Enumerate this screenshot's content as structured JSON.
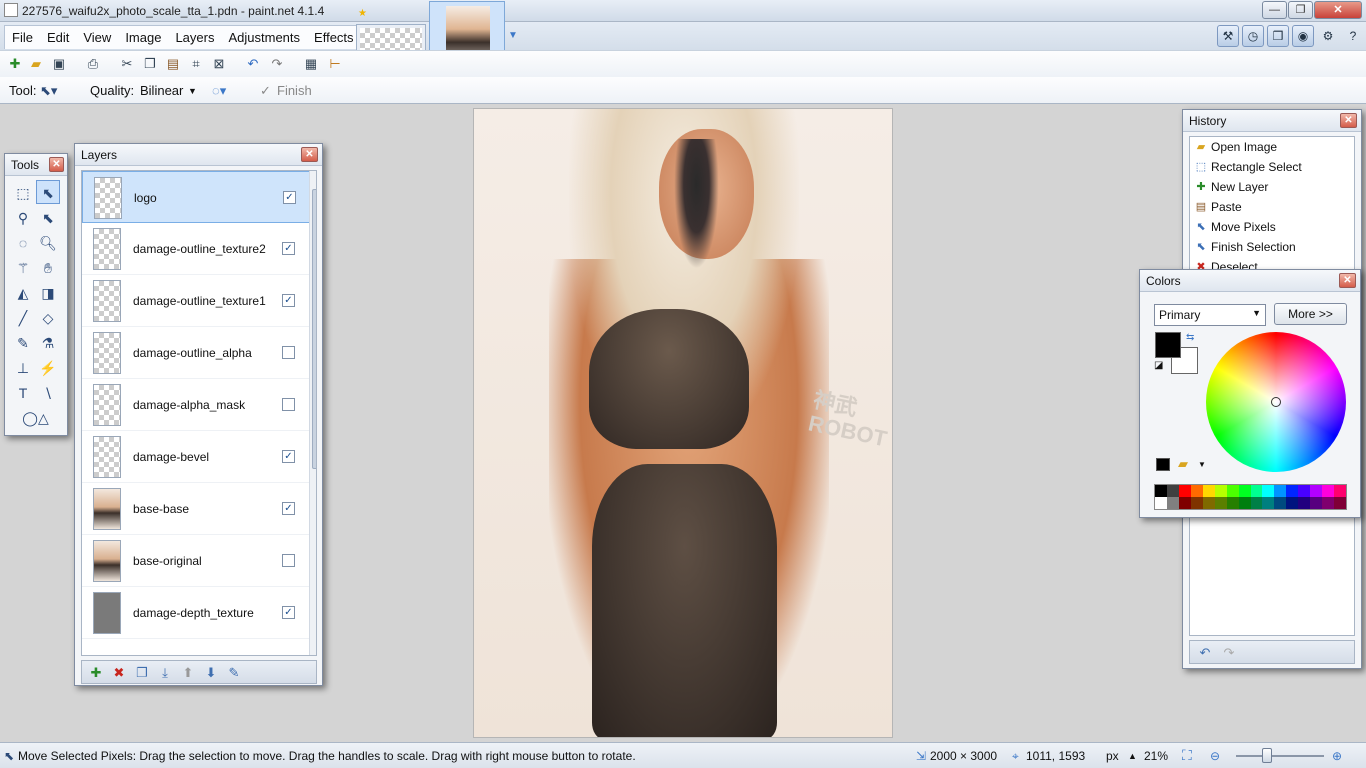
{
  "window": {
    "title": "227576_waifu2x_photo_scale_tta_1.pdn - paint.net 4.1.4",
    "min": "—",
    "max": "❐",
    "close": "✕"
  },
  "menu": [
    "File",
    "Edit",
    "View",
    "Image",
    "Layers",
    "Adjustments",
    "Effects"
  ],
  "tabs": {
    "thumb1_name": "logo document",
    "thumb2_name": "photo document",
    "active": 2
  },
  "toolbar": {
    "tool_label": "Tool:",
    "quality_label": "Quality:",
    "quality_value": "Bilinear",
    "finish_label": "Finish"
  },
  "tools_panel": {
    "title": "Tools",
    "close": "✕"
  },
  "layers_panel": {
    "title": "Layers",
    "close": "✕",
    "layers": [
      {
        "name": "logo",
        "visible": true,
        "thumb": "checker",
        "selected": true
      },
      {
        "name": "damage-outline_texture2",
        "visible": true,
        "thumb": "checker"
      },
      {
        "name": "damage-outline_texture1",
        "visible": true,
        "thumb": "checker"
      },
      {
        "name": "damage-outline_alpha",
        "visible": false,
        "thumb": "checker"
      },
      {
        "name": "damage-alpha_mask",
        "visible": false,
        "thumb": "checker"
      },
      {
        "name": "damage-bevel",
        "visible": true,
        "thumb": "checker"
      },
      {
        "name": "base-base",
        "visible": true,
        "thumb": "photo"
      },
      {
        "name": "base-original",
        "visible": false,
        "thumb": "photo"
      },
      {
        "name": "damage-depth_texture",
        "visible": true,
        "thumb": "gray"
      }
    ]
  },
  "history_panel": {
    "title": "History",
    "close": "✕",
    "items": [
      "Open Image",
      "Rectangle Select",
      "New Layer",
      "Paste",
      "Move Pixels",
      "Finish Selection",
      "Deselect"
    ]
  },
  "colors_panel": {
    "title": "Colors",
    "close": "✕",
    "mode": "Primary",
    "more_label": "More >>",
    "primary_color": "#000000",
    "secondary_color": "#ffffff",
    "palette_top": [
      "#000000",
      "#404040",
      "#ff0000",
      "#ff6a00",
      "#ffd800",
      "#b6ff00",
      "#4cff00",
      "#00ff21",
      "#00ff90",
      "#00ffff",
      "#0094ff",
      "#0026ff",
      "#4800ff",
      "#b200ff",
      "#ff00dc",
      "#ff006e"
    ],
    "palette_bottom": [
      "#ffffff",
      "#808080",
      "#7f0000",
      "#7f3300",
      "#7f6a00",
      "#5b7f00",
      "#267f00",
      "#007f0e",
      "#007f46",
      "#007f7f",
      "#004a7f",
      "#00137f",
      "#21007f",
      "#57007f",
      "#7f006e",
      "#7f0037"
    ]
  },
  "canvas": {
    "watermark_text": "神武 ROBOT"
  },
  "status": {
    "message": "Move Selected Pixels: Drag the selection to move. Drag the handles to scale. Drag with right mouse button to rotate.",
    "image_size": "2000 × 3000",
    "cursor_pos": "1011, 1593",
    "units": "px",
    "zoom": "21%"
  }
}
